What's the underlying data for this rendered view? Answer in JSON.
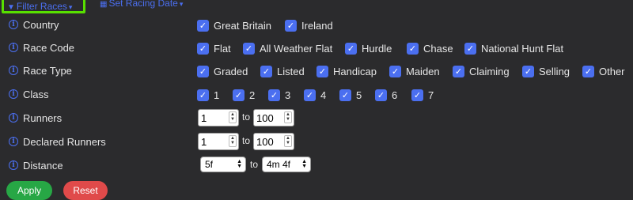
{
  "tabs": {
    "filter_races": "Filter Races",
    "set_racing_date": "Set Racing Date"
  },
  "country": {
    "label": "Country",
    "options": [
      {
        "label": "Great Britain",
        "checked": true
      },
      {
        "label": "Ireland",
        "checked": true
      }
    ]
  },
  "race_code": {
    "label": "Race Code",
    "options": [
      {
        "label": "Flat",
        "checked": true
      },
      {
        "label": "All Weather Flat",
        "checked": true
      },
      {
        "label": "Hurdle",
        "checked": true
      },
      {
        "label": "Chase",
        "checked": true
      },
      {
        "label": "National Hunt Flat",
        "checked": true
      }
    ]
  },
  "race_type": {
    "label": "Race Type",
    "options": [
      {
        "label": "Graded",
        "checked": true
      },
      {
        "label": "Listed",
        "checked": true
      },
      {
        "label": "Handicap",
        "checked": true
      },
      {
        "label": "Maiden",
        "checked": true
      },
      {
        "label": "Claiming",
        "checked": true
      },
      {
        "label": "Selling",
        "checked": true
      },
      {
        "label": "Other",
        "checked": true
      }
    ]
  },
  "class": {
    "label": "Class",
    "options": [
      {
        "label": "1",
        "checked": true
      },
      {
        "label": "2",
        "checked": true
      },
      {
        "label": "3",
        "checked": true
      },
      {
        "label": "4",
        "checked": true
      },
      {
        "label": "5",
        "checked": true
      },
      {
        "label": "6",
        "checked": true
      },
      {
        "label": "7",
        "checked": true
      }
    ]
  },
  "runners": {
    "label": "Runners",
    "min": "1",
    "to": "to",
    "max": "100"
  },
  "declared_runners": {
    "label": "Declared Runners",
    "min": "1",
    "to": "to",
    "max": "100"
  },
  "distance": {
    "label": "Distance",
    "min": "5f",
    "to": "to",
    "max": "4m 4f"
  },
  "buttons": {
    "apply": "Apply",
    "reset": "Reset"
  },
  "icons": {
    "info": "info-icon",
    "check": "check-icon",
    "filter": "filter-icon",
    "calendar": "calendar-icon"
  },
  "colors": {
    "accent": "#4b6ff0",
    "highlight": "#58e000",
    "background": "#2b2b2d",
    "apply": "#27a745",
    "reset": "#e04a4a"
  }
}
